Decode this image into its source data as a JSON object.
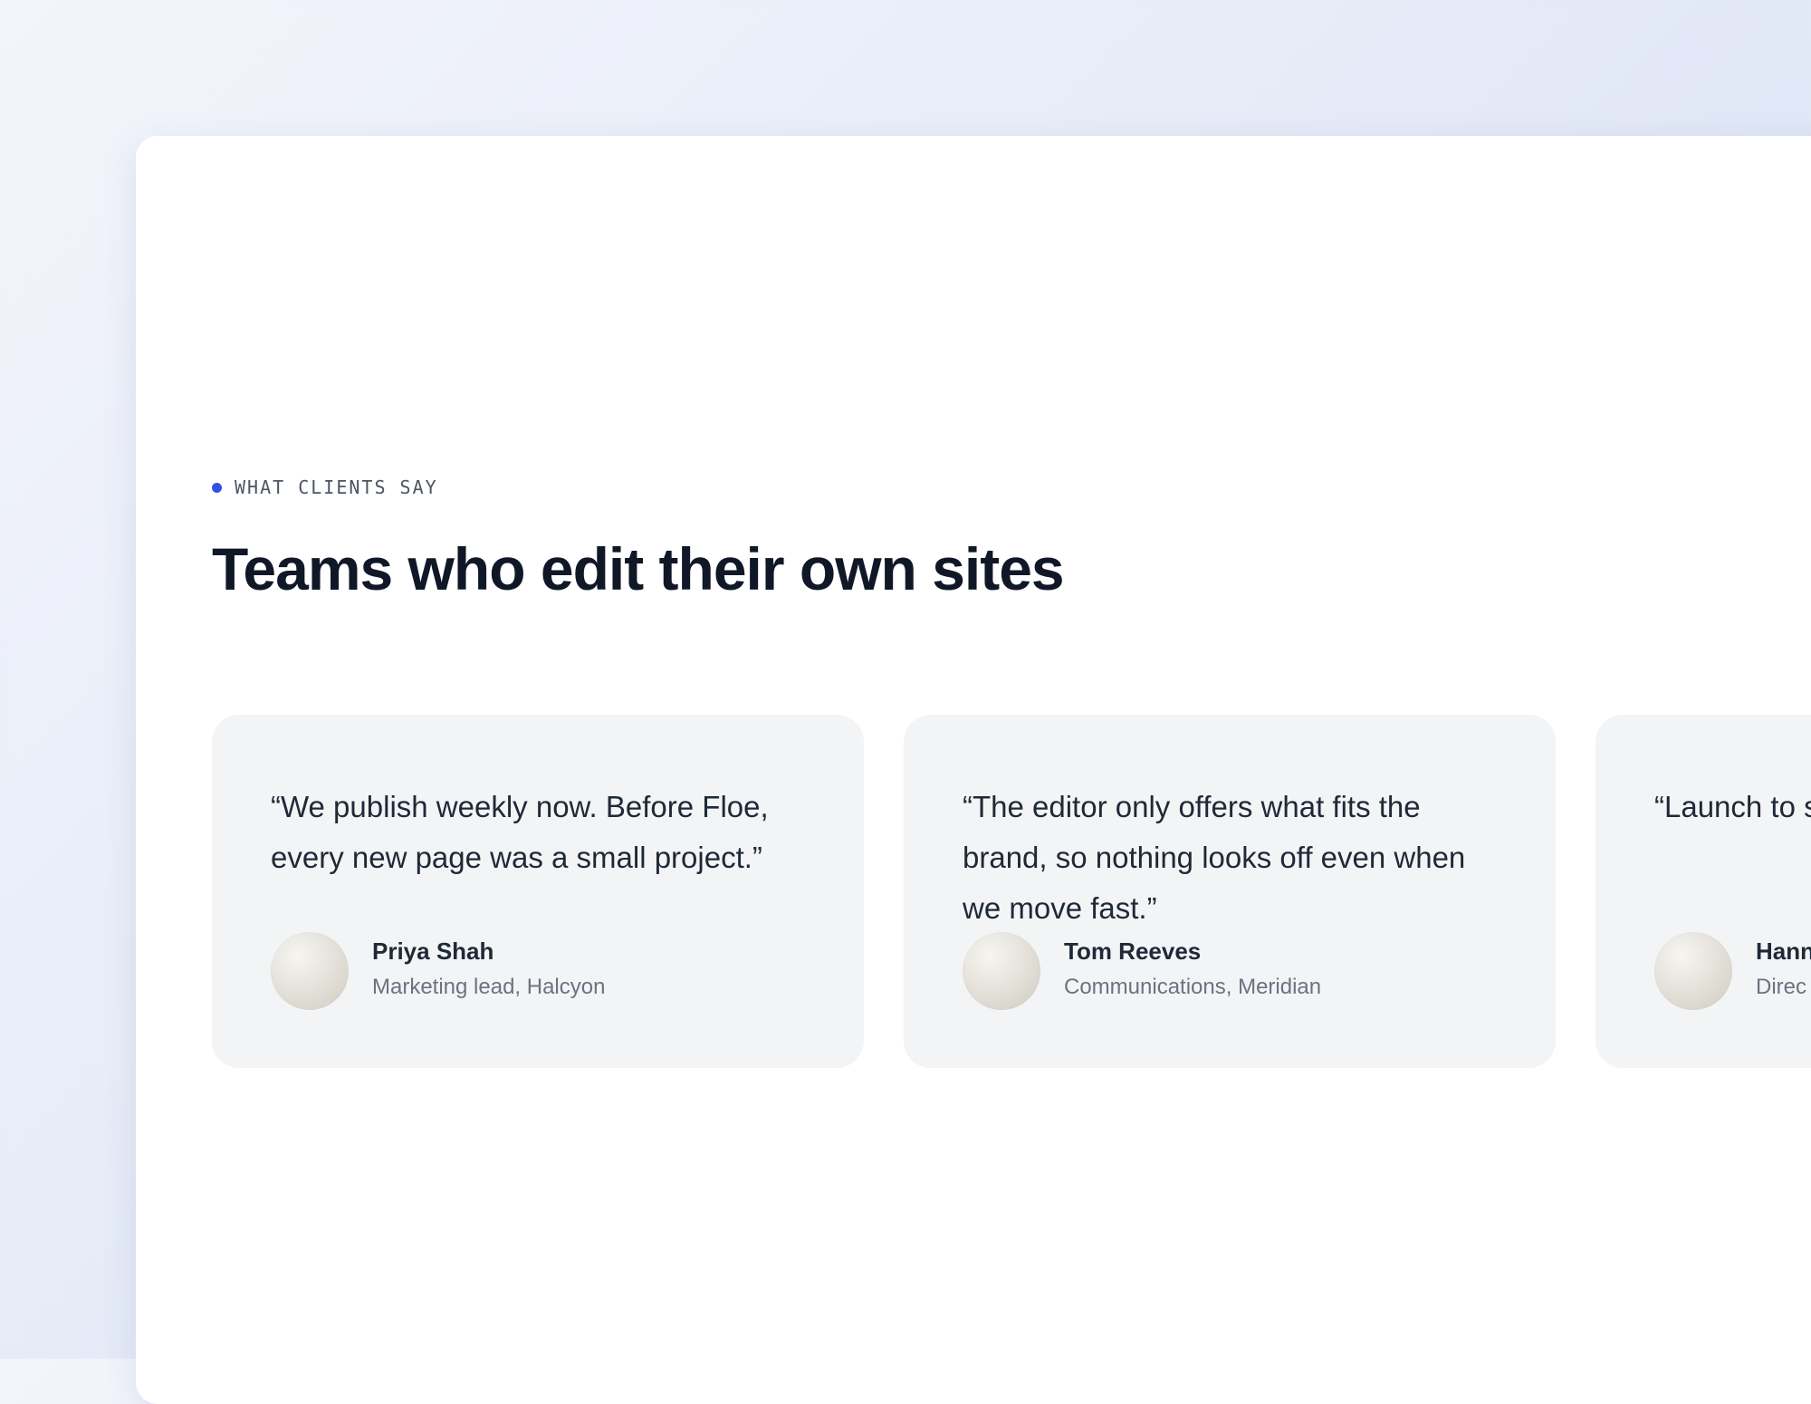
{
  "section": {
    "eyebrow": "WHAT CLIENTS SAY",
    "title": "Teams who edit their own sites"
  },
  "testimonials": [
    {
      "quote": "“We publish weekly now. Before Floe, every new page was a small project.”",
      "name": "Priya Shah",
      "role": "Marketing lead, Halcyon"
    },
    {
      "quote": "“The editor only offers what fits the brand, so nothing looks off even when we move fast.”",
      "name": "Tom Reeves",
      "role": "Communications, Meridian"
    },
    {
      "quote": "“Launch to site has gro without a n",
      "name": "Hann",
      "role": "Direc"
    }
  ],
  "colors": {
    "accent": "#3350e6",
    "heading": "#101828",
    "card_background": "#f3f4f6"
  }
}
